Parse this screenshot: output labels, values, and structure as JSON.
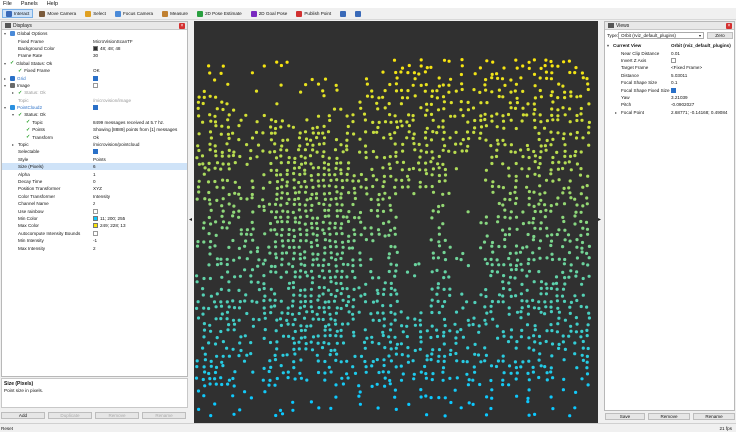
{
  "menu": [
    "File",
    "Panels",
    "Help"
  ],
  "toolbar": [
    {
      "label": "Interact",
      "icon": "interact-icon",
      "color": "#3a6ab8",
      "active": true
    },
    {
      "label": "Move Camera",
      "icon": "move-camera-icon",
      "color": "#7a5a3a"
    },
    {
      "label": "Select",
      "icon": "select-icon",
      "color": "#e0a020"
    },
    {
      "label": "Focus Camera",
      "icon": "focus-camera-icon",
      "color": "#4a8ad8"
    },
    {
      "label": "Measure",
      "icon": "measure-icon",
      "color": "#c08030"
    },
    {
      "label": "2D Pose Estimate",
      "icon": "pose-estimate-icon",
      "color": "#2aa040"
    },
    {
      "label": "2D Goal Pose",
      "icon": "goal-pose-icon",
      "color": "#7a2ac0"
    },
    {
      "label": "Publish Point",
      "icon": "publish-point-icon",
      "color": "#d03030"
    },
    {
      "label": "",
      "icon": "crosshair-icon",
      "color": "#3a6ab8"
    },
    {
      "label": "",
      "icon": "minus-icon",
      "color": "#3a6ab8"
    }
  ],
  "displays": {
    "title": "Displays",
    "rows": [
      {
        "indent": 0,
        "arrow": "▾",
        "icon": "gear-icon",
        "name": "Global Options",
        "value": ""
      },
      {
        "indent": 1,
        "name": "Fixed Frame",
        "value": "MicroVisionScanTF"
      },
      {
        "indent": 1,
        "name": "Background Color",
        "value": "48; 48; 48",
        "swatch": "#303030"
      },
      {
        "indent": 1,
        "name": "Frame Rate",
        "value": "30"
      },
      {
        "indent": 0,
        "arrow": "▾",
        "tick": true,
        "name": "Global Status: Ok",
        "value": ""
      },
      {
        "indent": 1,
        "tick": true,
        "name": "Fixed Frame",
        "value": "OK"
      },
      {
        "indent": 0,
        "arrow": "▸",
        "icon": "grid-icon",
        "name": "Grid",
        "value": "",
        "check": true,
        "nameClass": "blue"
      },
      {
        "indent": 0,
        "arrow": "▾",
        "icon": "image-icon",
        "name": "Image",
        "value": "",
        "check": false
      },
      {
        "indent": 1,
        "arrow": "▸",
        "tick": true,
        "name": "Status: Ok",
        "value": "",
        "nameClass": "dim"
      },
      {
        "indent": 1,
        "name": "Topic",
        "value": "/microvision/image",
        "nameClass": "dim",
        "valClass": "dim"
      },
      {
        "indent": 0,
        "arrow": "▾",
        "icon": "pointcloud-icon",
        "name": "PointCloud2",
        "value": "",
        "check": true,
        "nameClass": "blue"
      },
      {
        "indent": 1,
        "arrow": "▾",
        "tick": true,
        "name": "Status: Ok",
        "value": ""
      },
      {
        "indent": 2,
        "tick": true,
        "name": "Topic",
        "value": "8499 messages received at 5.7 hz."
      },
      {
        "indent": 2,
        "tick": true,
        "name": "Points",
        "value": "Showing [8889] points from [1] messages"
      },
      {
        "indent": 2,
        "tick": true,
        "name": "Transform",
        "value": "Ok"
      },
      {
        "indent": 1,
        "arrow": "▸",
        "name": "Topic",
        "value": "/microvision/pointcloud"
      },
      {
        "indent": 1,
        "name": "Selectable",
        "value": "",
        "check": true
      },
      {
        "indent": 1,
        "name": "Style",
        "value": "Points"
      },
      {
        "indent": 1,
        "name": "Size (Pixels)",
        "value": "6",
        "selected": true
      },
      {
        "indent": 1,
        "name": "Alpha",
        "value": "1"
      },
      {
        "indent": 1,
        "name": "Decay Time",
        "value": "0"
      },
      {
        "indent": 1,
        "name": "Position Transformer",
        "value": "XYZ"
      },
      {
        "indent": 1,
        "name": "Color Transformer",
        "value": "Intensity"
      },
      {
        "indent": 1,
        "name": "Channel Name",
        "value": "z"
      },
      {
        "indent": 1,
        "name": "Use rainbow",
        "value": "",
        "check": false
      },
      {
        "indent": 1,
        "name": "Min Color",
        "value": "11; 200; 255",
        "swatch": "#0bc8ff"
      },
      {
        "indent": 1,
        "name": "Max Color",
        "value": "249; 228; 13",
        "swatch": "#f9e40d"
      },
      {
        "indent": 1,
        "name": "Autocompute Intensity Bounds",
        "value": "",
        "check": false
      },
      {
        "indent": 1,
        "name": "Min Intensity",
        "value": "-1"
      },
      {
        "indent": 1,
        "name": "Max Intensity",
        "value": "2"
      }
    ],
    "help_title": "Size (Pixels)",
    "help_text": "Point size in pixels.",
    "buttons": [
      "Add",
      "Duplicate",
      "Remove",
      "Rename"
    ]
  },
  "views": {
    "title": "Views",
    "type_label": "Type:",
    "type_value": "Orbit (rviz_default_plugins)",
    "zero_label": "Zero",
    "header_name": "Current View",
    "header_value": "Orbit (rviz_default_plugins)",
    "rows": [
      {
        "name": "Near Clip Distance",
        "value": "0.01"
      },
      {
        "name": "Invert Z Axis",
        "value": "",
        "check": false
      },
      {
        "name": "Target Frame",
        "value": "<Fixed Frame>"
      },
      {
        "name": "Distance",
        "value": "5.03011"
      },
      {
        "name": "Focal Shape Size",
        "value": "0.1"
      },
      {
        "name": "Focal Shape Fixed Size",
        "value": "",
        "check": true
      },
      {
        "name": "Yaw",
        "value": "3.21039"
      },
      {
        "name": "Pitch",
        "value": "-0.0902027"
      },
      {
        "name": "Focal Point",
        "value": "2.68771; -0.14168; 0.49084",
        "arrow": "▸"
      }
    ],
    "buttons": [
      "Save",
      "Remove",
      "Rename"
    ]
  },
  "status": {
    "reset_label": "Reset",
    "fps": "21 fps"
  },
  "viewport": {
    "background": "#303030"
  }
}
